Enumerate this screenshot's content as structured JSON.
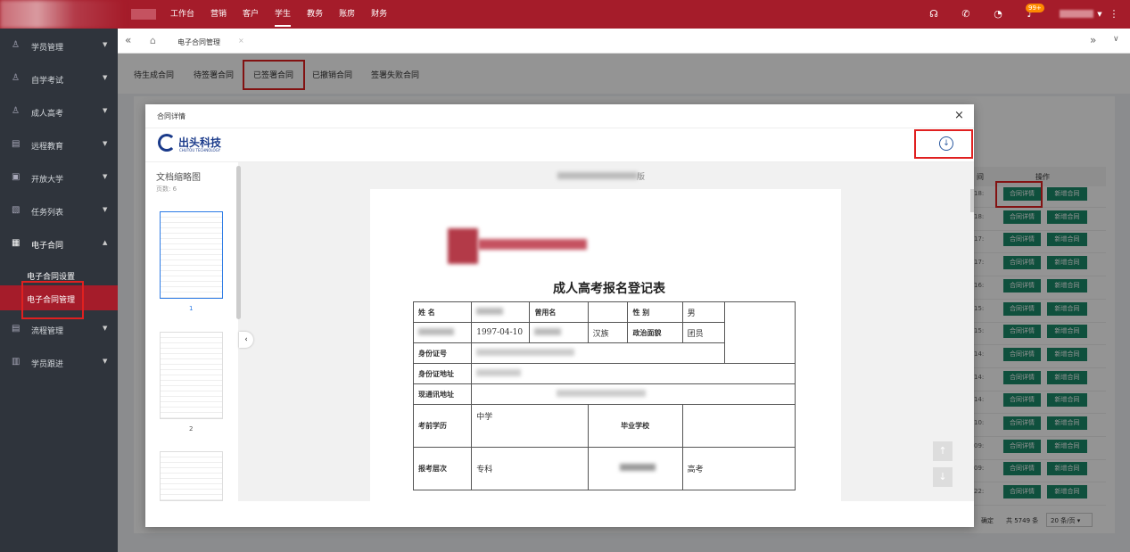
{
  "topnav": {
    "items": [
      "工作台",
      "营销",
      "客户",
      "学生",
      "教务",
      "账房",
      "财务"
    ],
    "active_index": 3,
    "badge": "99+"
  },
  "sidebar": {
    "items": [
      {
        "label": "学员管理",
        "icon": "user-icon"
      },
      {
        "label": "自学考试",
        "icon": "user-icon"
      },
      {
        "label": "成人高考",
        "icon": "user-icon"
      },
      {
        "label": "远程教育",
        "icon": "grid-icon"
      },
      {
        "label": "开放大学",
        "icon": "grid-icon"
      },
      {
        "label": "任务列表",
        "icon": "grid-icon"
      },
      {
        "label": "电子合同",
        "icon": "doc-icon"
      }
    ],
    "sub_items": [
      "电子合同设置",
      "电子合同管理"
    ],
    "after_items": [
      {
        "label": "流程管理",
        "icon": "grid-icon"
      },
      {
        "label": "学员跟进",
        "icon": "doc-icon"
      }
    ]
  },
  "tabs": {
    "current": "电子合同管理"
  },
  "filter_tabs": [
    "待生成合同",
    "待签署合同",
    "已签署合同",
    "已撤销合同",
    "签署失败合同"
  ],
  "table": {
    "header_op": "操作",
    "header_partial": "间",
    "btn_detail": "合同详情",
    "btn_add": "新增合同",
    "time_fragments": [
      "18:",
      "18:",
      "17:",
      "17:",
      "16:",
      "15:",
      "15:",
      "14:",
      "14:",
      "14:",
      "10:",
      "09:",
      "09:",
      "22:"
    ],
    "pager_confirm": "确定",
    "pager_total": "共 5749 条",
    "pager_size": "20 条/页"
  },
  "modal": {
    "title": "合同详情",
    "brand": "出头科技",
    "brand_en": "CHUTOU TECHNOLOGY",
    "thumb_title": "文档缩略图",
    "page_count": "页数: 6",
    "thumb_pages": [
      "1",
      "2"
    ],
    "doc_header_partial": "版",
    "form_title": "成人高考报名登记表",
    "form": {
      "name_label": "姓  名",
      "alias_label": "曾用名",
      "gender_label": "性  别",
      "gender_value": "男",
      "birth_value": "1997-04-10",
      "ethnic_value": "汉族",
      "political_label": "政治面貌",
      "political_value": "团员",
      "id_label": "身份证号",
      "id_addr_label": "身份证地址",
      "addr_label": "现通讯地址",
      "edu_label": "考前学历",
      "edu_value": "中学",
      "school_label": "毕业学校",
      "level_label": "报考层次",
      "level_value": "专科",
      "exam_value": "高考"
    }
  },
  "colors": {
    "brand": "#a51c2a",
    "sidebar": "#2f343c",
    "op_btn": "#1a8a6a",
    "highlight": "#e02020"
  }
}
